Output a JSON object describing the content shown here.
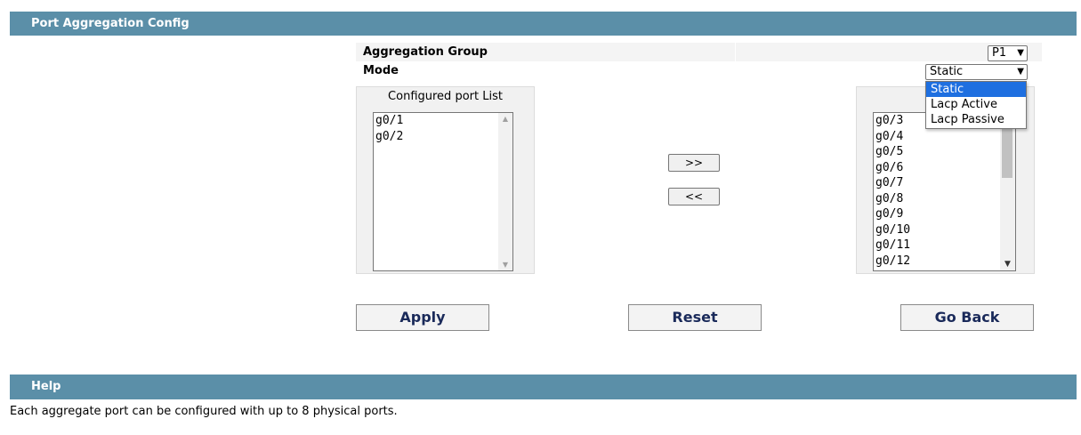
{
  "config_section": {
    "title": "Port Aggregation Config",
    "aggregation_group_label": "Aggregation Group",
    "aggregation_group_value": "P1",
    "mode_label": "Mode",
    "mode_value": "Static",
    "mode_options": [
      "Static",
      "Lacp Active",
      "Lacp Passive"
    ]
  },
  "configured_list": {
    "title": "Configured port List",
    "items": [
      "g0/1",
      "g0/2"
    ]
  },
  "available_list": {
    "title": "Availa",
    "items": [
      "g0/3",
      "g0/4",
      "g0/5",
      "g0/6",
      "g0/7",
      "g0/8",
      "g0/9",
      "g0/10",
      "g0/11",
      "g0/12"
    ]
  },
  "move_buttons": {
    "add": ">>",
    "remove": "<<"
  },
  "actions": {
    "apply": "Apply",
    "reset": "Reset",
    "go_back": "Go Back"
  },
  "help_section": {
    "title": "Help",
    "text": "Each aggregate port can be configured with up to 8 physical ports."
  },
  "icons": {
    "select_arrow": "chevron-down-icon",
    "scroll_up": "triangle-up-icon",
    "scroll_down": "triangle-down-icon"
  },
  "colors": {
    "section_bar": "#5b8fa8",
    "dropdown_highlight": "#1e6fe0",
    "button_text": "#1a2a5a"
  }
}
